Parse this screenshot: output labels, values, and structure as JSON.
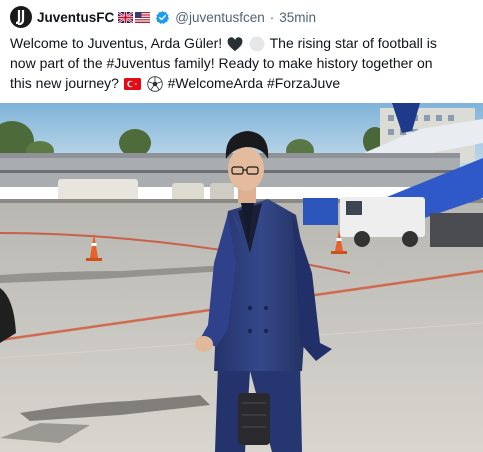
{
  "post": {
    "display_name": "JuventusFC",
    "handle": "@juventusfcen",
    "separator": "·",
    "time": "35min",
    "icons": [
      "juventus-logo",
      "uk-flag",
      "us-flag",
      "verified-badge"
    ],
    "text": {
      "line1_a": "Welcome to Juventus, Arda Güler!",
      "line1_b": "The rising star of football is",
      "line2": "now part of the #Juventus family! Ready to make history together on",
      "line3_a": "this new journey?",
      "line3_b": "#WelcomeArda #ForzaJuve"
    },
    "emojis": [
      "black-heart",
      "white-circle",
      "turkey-flag",
      "soccer-ball"
    ],
    "colors": {
      "verified": "#1d9bf0",
      "handle": "#536471",
      "text": "#0f1419",
      "suit": "#2b3a72"
    }
  }
}
